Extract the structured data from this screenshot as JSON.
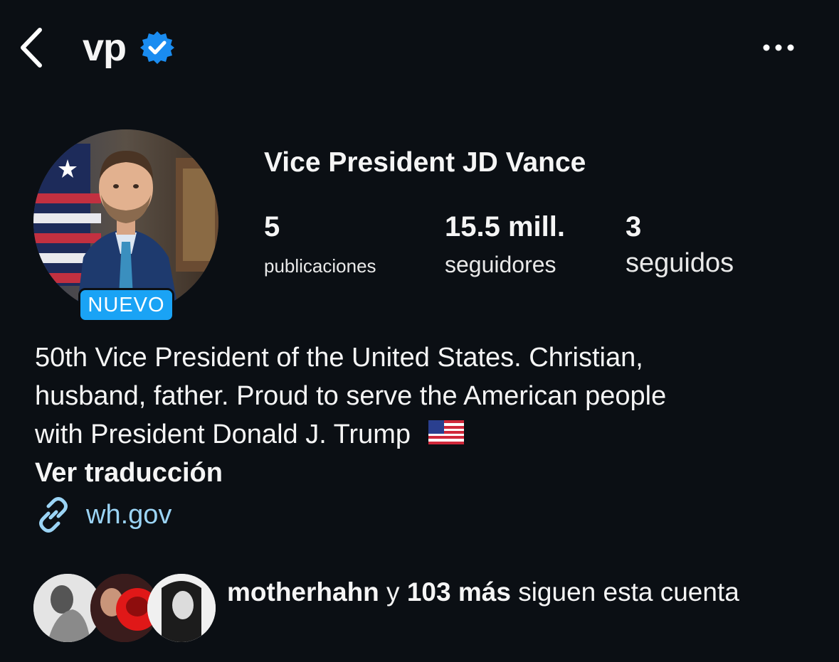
{
  "header": {
    "username": "vp",
    "back_icon": "chevron-left-icon",
    "verified_icon": "verified-badge-icon",
    "more_icon": "ellipsis-horizontal-icon"
  },
  "profile": {
    "display_name": "Vice President JD Vance",
    "badge": "NUEVO",
    "stats": {
      "posts_value": "5",
      "posts_label": "publicaciones",
      "followers_value": "15.5 mill.",
      "followers_label": "seguidores",
      "following_value": "3",
      "following_label": "seguidos"
    },
    "bio_lines": [
      "50th Vice President of the United States. Christian,",
      "husband, father. Proud to serve the American people",
      "with President Donald J. Trump"
    ],
    "bio_emoji": "us-flag-icon",
    "see_translation": "Ver traducción",
    "link_icon": "link-icon",
    "link": "wh.gov"
  },
  "mutual_followers": {
    "name": "motherhahn",
    "connector": " y ",
    "count_text": "103 más",
    "suffix": " siguen esta cuenta"
  },
  "colors": {
    "background": "#0b0f14",
    "badge": "#1aa3f5",
    "link": "#9bd4f5",
    "verified": "#1a8cf0"
  }
}
